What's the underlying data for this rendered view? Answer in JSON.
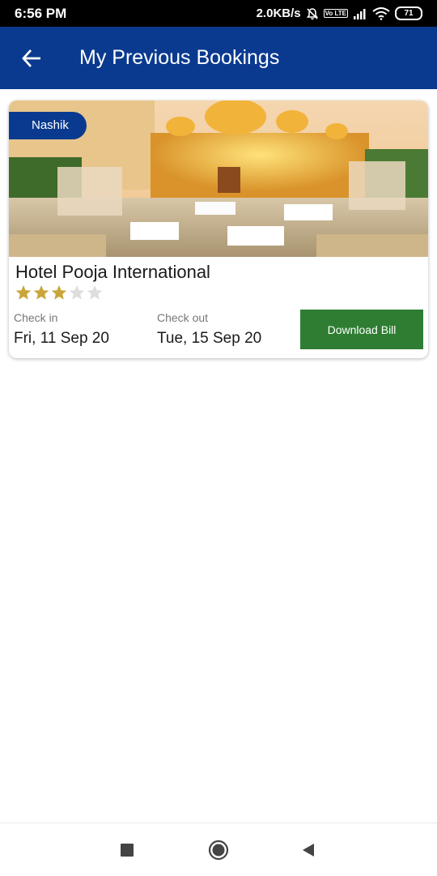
{
  "status_bar": {
    "time": "6:56 PM",
    "network_speed": "2.0KB/s",
    "volte_label": "Vo LTE",
    "battery_level": "71",
    "icons": [
      "alarm-off-icon",
      "volte-icon",
      "signal-icon",
      "wifi-icon",
      "battery-icon"
    ]
  },
  "header": {
    "title": "My Previous Bookings",
    "back_icon": "back-arrow-icon",
    "background": "#0a3a8f"
  },
  "bookings": [
    {
      "city": "Nashik",
      "hotel_name": "Hotel Pooja International",
      "rating": 3,
      "rating_max": 5,
      "check_in_label": "Check in",
      "check_in_value": "Fri, 11 Sep 20",
      "check_out_label": "Check out",
      "check_out_value": "Tue, 15 Sep 20",
      "download_label": "Download Bill",
      "download_color": "#2e7d32"
    }
  ],
  "nav_bar": {
    "icons": [
      "recent-apps-icon",
      "home-icon",
      "back-nav-icon"
    ]
  },
  "colors": {
    "primary": "#0a3a8f",
    "star_filled": "#c9a53a",
    "star_empty": "#dddddd"
  }
}
